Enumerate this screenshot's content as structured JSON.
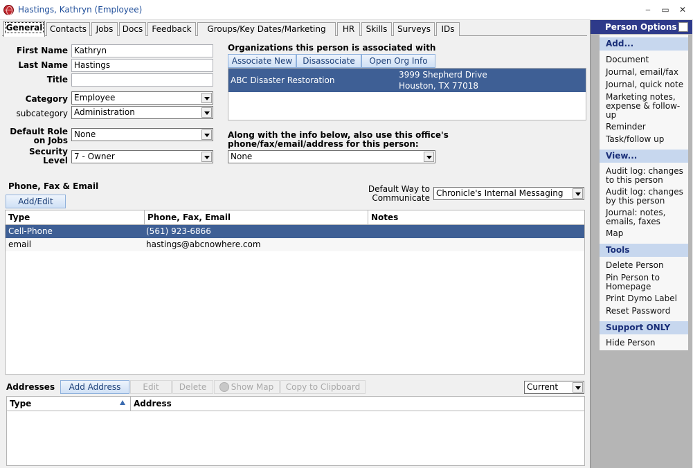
{
  "window": {
    "title": "Hastings, Kathryn (Employee)",
    "controls": [
      "‒",
      "▭",
      "✕"
    ]
  },
  "tabs": [
    "General",
    "Contacts",
    "Jobs",
    "Docs",
    "Feedback",
    "Groups/Key Dates/Marketing",
    "HR",
    "Skills",
    "Surveys",
    "IDs"
  ],
  "form": {
    "first_name_label": "First Name",
    "first_name": "Kathryn",
    "last_name_label": "Last Name",
    "last_name": "Hastings",
    "title_label": "Title",
    "title": "",
    "category_label": "Category",
    "category": "Employee",
    "subcategory_label": "subcategory",
    "subcategory": "Administration",
    "default_role_label_1": "Default Role",
    "default_role_label_2": "on Jobs",
    "default_role": "None",
    "security_label_1": "Security",
    "security_label_2": "Level",
    "security_level": "7 - Owner"
  },
  "orgs": {
    "heading": "Organizations this person is associated with",
    "associate_new": "Associate New",
    "disassociate": "Disassociate",
    "open_org_info": "Open Org Info",
    "rows": [
      {
        "name": "ABC Disaster Restoration",
        "address1": "3999 Shepherd Drive",
        "address2": "Houston, TX  77018"
      }
    ]
  },
  "office": {
    "label_1": "Along with the info below, also use this office's",
    "label_2": "phone/fax/email/address for this person:",
    "value": "None"
  },
  "phone": {
    "heading": "Phone, Fax & Email",
    "add_edit": "Add/Edit",
    "default_way_label_1": "Default Way to",
    "default_way_label_2": "Communicate",
    "default_way": "Chronicle's Internal Messaging",
    "columns": [
      "Type",
      "Phone, Fax, Email",
      "Notes"
    ],
    "rows": [
      {
        "type": "Cell-Phone",
        "value": "(561) 923-6866",
        "notes": ""
      },
      {
        "type": "email",
        "value": "hastings@abcnowhere.com",
        "notes": ""
      }
    ]
  },
  "addresses": {
    "heading": "Addresses",
    "add_address": "Add Address",
    "edit": "Edit",
    "delete": "Delete",
    "show_map": "Show Map",
    "copy": "Copy to Clipboard",
    "filter": "Current",
    "columns": [
      "Type",
      "Address"
    ]
  },
  "person_options": {
    "title": "Person Options",
    "sections": [
      {
        "title": "Add...",
        "items": [
          "Document",
          "Journal, email/fax",
          "Journal, quick note",
          "Marketing notes, expense & follow-up",
          "Reminder",
          "Task/follow up"
        ]
      },
      {
        "title": "View...",
        "items": [
          "Audit log: changes to this person",
          "Audit log: changes by this person",
          "Journal: notes, emails, faxes",
          "Map"
        ]
      },
      {
        "title": "Tools",
        "items": [
          "Delete Person",
          "Pin Person to Homepage",
          "Print Dymo Label",
          "Reset Password"
        ]
      },
      {
        "title": "Support ONLY",
        "items": [
          "Hide Person"
        ]
      }
    ]
  },
  "colors": {
    "selection": "#3e5f95",
    "panel_header": "#2e3a8a",
    "section_bg": "#c7d7ee"
  }
}
